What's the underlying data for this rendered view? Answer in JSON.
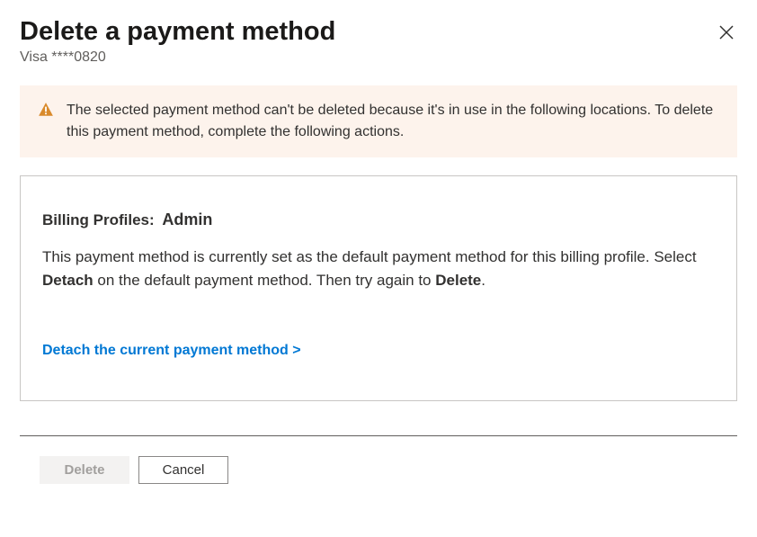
{
  "dialog": {
    "title": "Delete a payment method",
    "subtitle": "Visa ****0820"
  },
  "warning": {
    "message": "The selected payment method can't be deleted because it's in use in the following locations. To delete this payment method, complete the following actions."
  },
  "card": {
    "profile_label": "Billing Profiles:",
    "profile_name": "Admin",
    "desc_part1": "This payment method is currently set as the default payment method for this billing profile. Select ",
    "desc_strong1": "Detach",
    "desc_part2": " on the default payment method. Then try again to ",
    "desc_strong2": "Delete",
    "desc_part3": ".",
    "link_text": "Detach the current payment method >"
  },
  "buttons": {
    "delete": "Delete",
    "cancel": "Cancel"
  }
}
